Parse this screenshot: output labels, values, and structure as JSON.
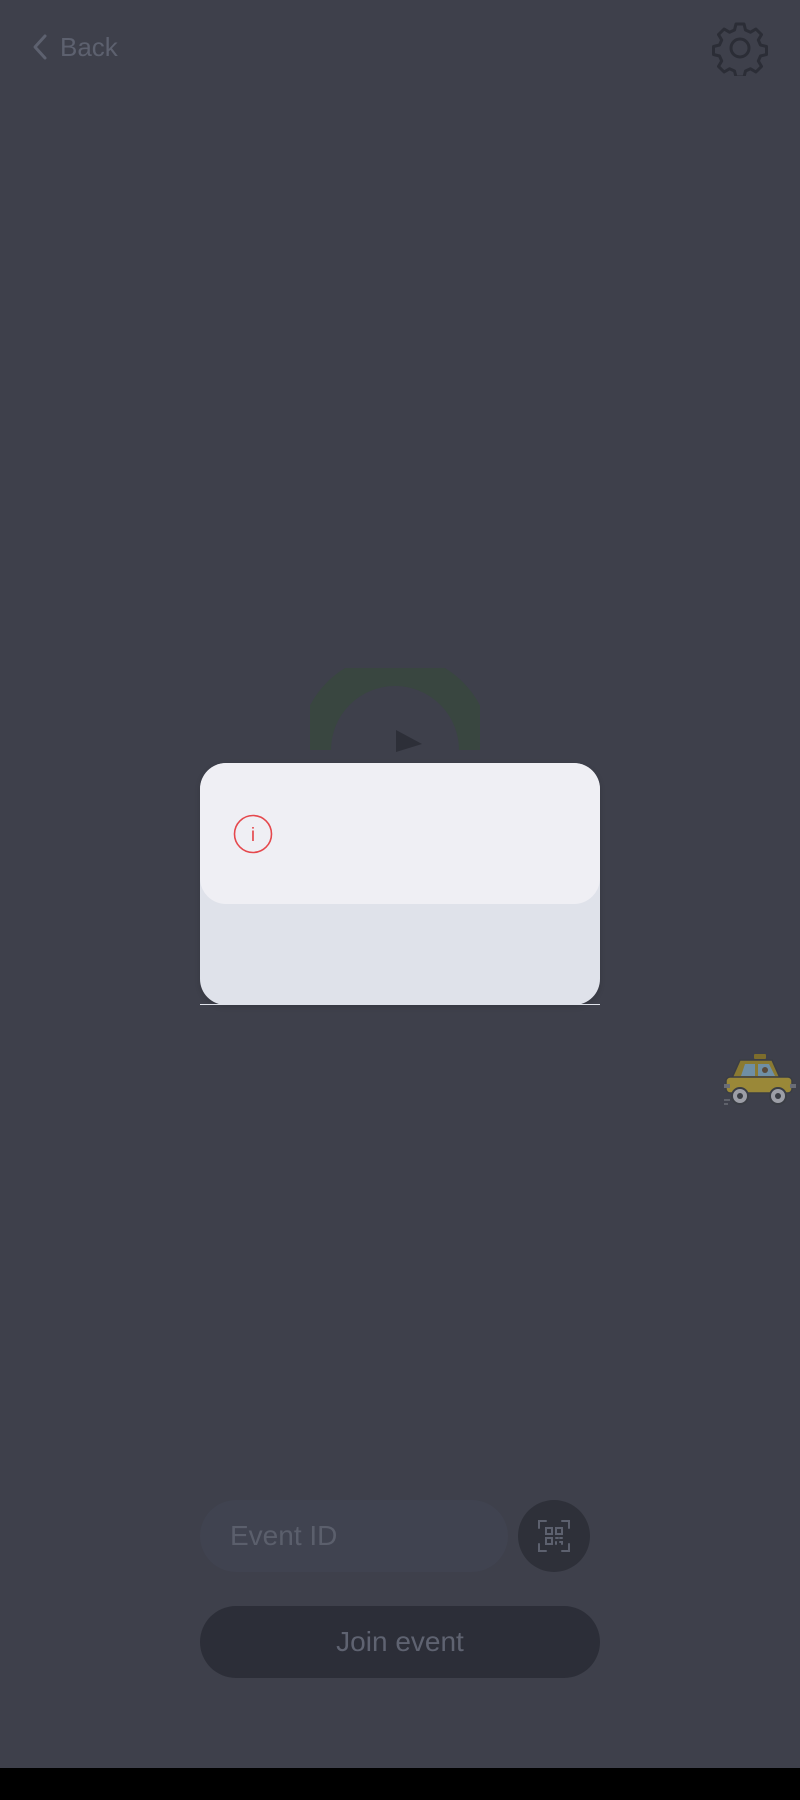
{
  "header": {
    "back_label": "Back",
    "back_icon": "chevron-left-icon",
    "settings_icon": "gear-icon"
  },
  "dialog": {
    "icon": "info-icon",
    "icon_glyph": "i",
    "icon_color": "#e5484d"
  },
  "form": {
    "event_id_placeholder": "Event ID",
    "event_id_value": "",
    "qr_icon": "qr-scan-icon",
    "join_label": "Join event"
  },
  "colors": {
    "background": "#3e404b",
    "dialog_header": "#efeff4",
    "dialog_body": "#dfe2ea",
    "button_dark": "#2c2e38",
    "accent_error": "#e5484d"
  }
}
